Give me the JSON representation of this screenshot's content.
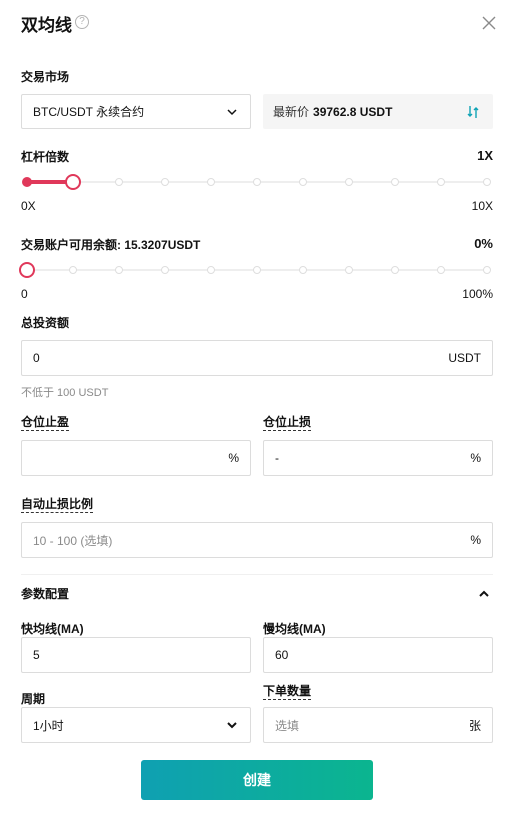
{
  "header": {
    "title": "双均线",
    "help_glyph": "?"
  },
  "market": {
    "label": "交易市场",
    "selected": "BTC/USDT 永续合约",
    "price_label": "最新价",
    "price_value": "39762.8 USDT"
  },
  "leverage": {
    "label": "杠杆倍数",
    "value": "1X",
    "min_label": "0X",
    "max_label": "10X",
    "level": 0.1
  },
  "balance": {
    "label": "交易账户可用余额: 15.3207USDT",
    "percent": "0%",
    "min_label": "0",
    "max_label": "100%",
    "level": 0
  },
  "investment": {
    "label": "总投资额",
    "value": "0",
    "unit": "USDT",
    "hint": "不低于 100 USDT"
  },
  "take_profit": {
    "label": "仓位止盈",
    "value": "",
    "unit": "%"
  },
  "stop_loss": {
    "label": "仓位止损",
    "value": "-",
    "unit": "%"
  },
  "auto_stop": {
    "label": "自动止损比例",
    "placeholder": "10 - 100 (选填)",
    "unit": "%"
  },
  "params": {
    "section_label": "参数配置",
    "fast_ma_label": "快均线(MA)",
    "fast_ma_value": "5",
    "slow_ma_label": "慢均线(MA)",
    "slow_ma_value": "60",
    "period_label": "周期",
    "period_value": "1小时",
    "order_qty_label": "下单数量",
    "order_qty_placeholder": "选填",
    "order_qty_unit": "张"
  },
  "footer": {
    "create_label": "创建"
  },
  "colors": {
    "accent": "#e0385a",
    "button_start": "#0fa0b2",
    "button_end": "#0bb58f"
  }
}
